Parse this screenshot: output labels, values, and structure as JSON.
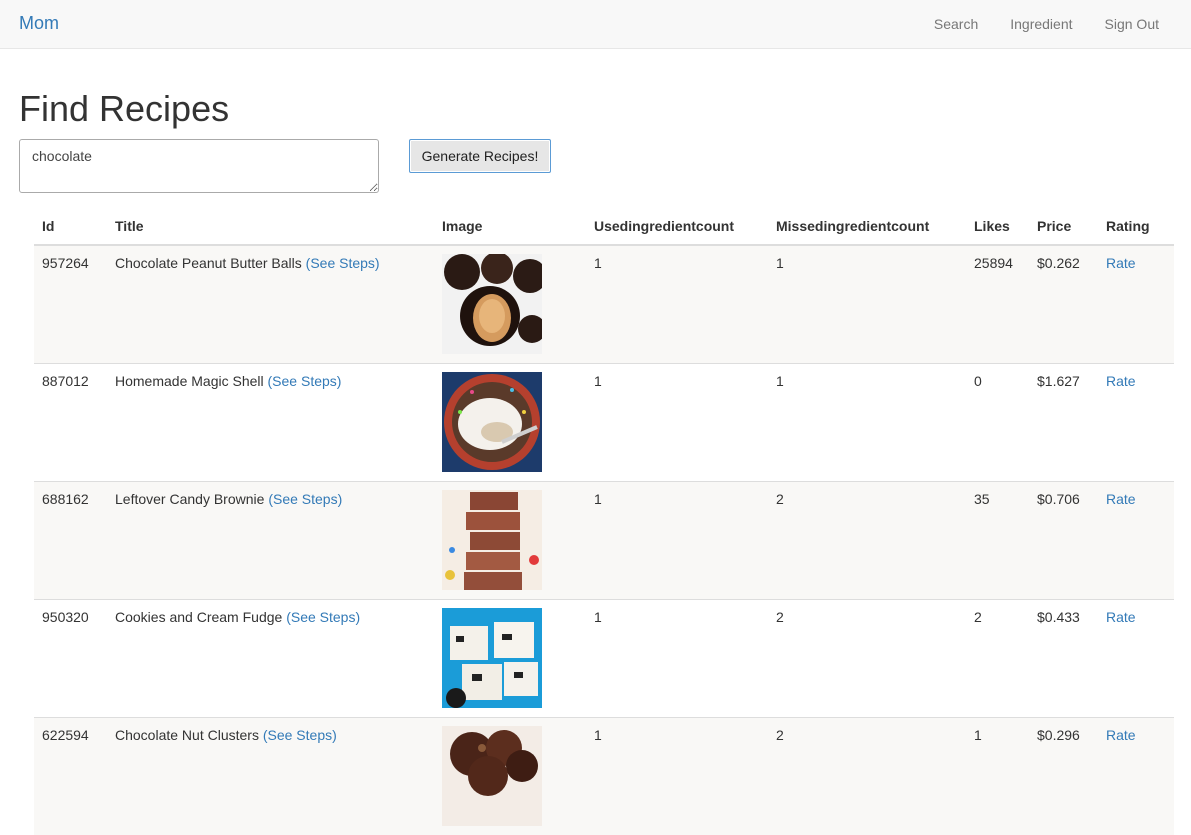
{
  "nav": {
    "brand": "Mom",
    "links": [
      "Search",
      "Ingredient",
      "Sign Out"
    ]
  },
  "page_title": "Find Recipes",
  "search": {
    "value": "chocolate"
  },
  "generate_button": "Generate Recipes!",
  "table": {
    "headers": [
      "Id",
      "Title",
      "Image",
      "Usedingredientcount",
      "Missedingredientcount",
      "Likes",
      "Price",
      "Rating"
    ],
    "rows": [
      {
        "id": "957264",
        "title": "Chocolate Peanut Butter Balls",
        "steps": "(See Steps)",
        "used": "1",
        "missed": "1",
        "likes": "25894",
        "price": "$0.262",
        "rating": "Rate",
        "image": "chocolate-peanut-butter-balls-photo"
      },
      {
        "id": "887012",
        "title": "Homemade Magic Shell",
        "steps": "(See Steps)",
        "used": "1",
        "missed": "1",
        "likes": "0",
        "price": "$1.627",
        "rating": "Rate",
        "image": "magic-shell-photo"
      },
      {
        "id": "688162",
        "title": "Leftover Candy Brownie",
        "steps": "(See Steps)",
        "used": "1",
        "missed": "2",
        "likes": "35",
        "price": "$0.706",
        "rating": "Rate",
        "image": "candy-brownie-photo"
      },
      {
        "id": "950320",
        "title": "Cookies and Cream Fudge",
        "steps": "(See Steps)",
        "used": "1",
        "missed": "2",
        "likes": "2",
        "price": "$0.433",
        "rating": "Rate",
        "image": "cookies-cream-fudge-photo"
      },
      {
        "id": "622594",
        "title": "Chocolate Nut Clusters",
        "steps": "(See Steps)",
        "used": "1",
        "missed": "2",
        "likes": "1",
        "price": "$0.296",
        "rating": "Rate",
        "image": "nut-clusters-photo"
      }
    ]
  }
}
